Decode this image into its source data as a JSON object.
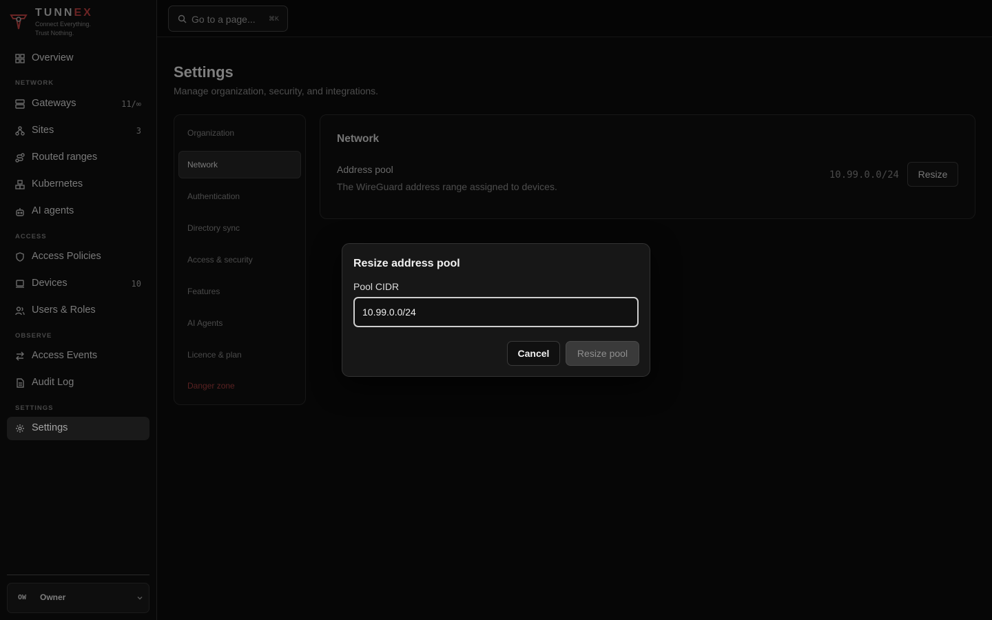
{
  "brand": {
    "name_prefix": "TUNN",
    "name_accent": "EX",
    "tagline_line1": "Connect Everything.",
    "tagline_line2": "Trust Nothing.",
    "accent_color": "#8a2a2a"
  },
  "search": {
    "placeholder": "Go to a page...",
    "shortcut": "⌘K",
    "icon": "search-icon"
  },
  "sidebar": {
    "overview": {
      "label": "Overview",
      "icon": "grid-icon"
    },
    "sections": {
      "network": "NETWORK",
      "access": "ACCESS",
      "observe": "OBSERVE",
      "settings": "SETTINGS"
    },
    "items": [
      {
        "label": "Gateways",
        "count": "11/∞",
        "icon": "server-icon"
      },
      {
        "label": "Sites",
        "count": "3",
        "icon": "network-icon"
      },
      {
        "label": "Routed ranges",
        "count": "",
        "icon": "route-icon"
      },
      {
        "label": "Kubernetes",
        "count": "",
        "icon": "boxes-icon"
      },
      {
        "label": "AI agents",
        "count": "",
        "icon": "bot-icon"
      },
      {
        "label": "Access Policies",
        "count": "",
        "icon": "shield-icon"
      },
      {
        "label": "Devices",
        "count": "10",
        "icon": "laptop-icon"
      },
      {
        "label": "Users & Roles",
        "count": "",
        "icon": "users-icon"
      },
      {
        "label": "Access Events",
        "count": "",
        "icon": "arrows-icon"
      },
      {
        "label": "Audit Log",
        "count": "",
        "icon": "file-icon"
      },
      {
        "label": "Settings",
        "count": "",
        "icon": "gear-icon",
        "active": true
      }
    ],
    "user": {
      "initials": "OW",
      "role": "Owner"
    }
  },
  "page": {
    "title": "Settings",
    "subtitle": "Manage organization, security, and integrations."
  },
  "subnav": [
    {
      "label": "Organization"
    },
    {
      "label": "Network",
      "active": true
    },
    {
      "label": "Authentication"
    },
    {
      "label": "Directory sync"
    },
    {
      "label": "Access & security"
    },
    {
      "label": "Features"
    },
    {
      "label": "AI Agents"
    },
    {
      "label": "Licence & plan"
    },
    {
      "label": "Danger zone",
      "danger": true
    }
  ],
  "network_card": {
    "title": "Network",
    "field_label": "Address pool",
    "field_desc": "The WireGuard address range assigned to devices.",
    "value": "10.99.0.0/24",
    "button": "Resize"
  },
  "modal": {
    "title": "Resize address pool",
    "label": "Pool CIDR",
    "input_value": "10.99.0.0/24",
    "cancel": "Cancel",
    "submit": "Resize pool"
  }
}
